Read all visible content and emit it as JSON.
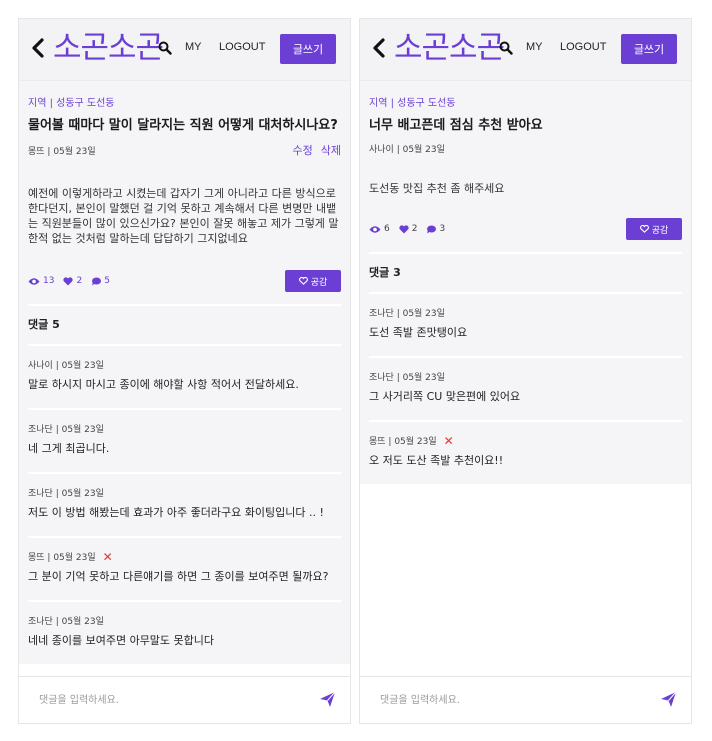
{
  "app": {
    "logo": "소곤소곤",
    "nav_my": "MY",
    "nav_logout": "LOGOUT",
    "write_label": "글쓰기",
    "accent_color": "#6b3fd4",
    "delete_color": "#e03a2e"
  },
  "left": {
    "post": {
      "region": "지역 | 성동구 도선동",
      "title": "물어볼 때마다 말이 달라지는 직원 어떻게 대처하시나요?",
      "author_date": "몽뜨  |  05월 23일",
      "edit_label": "수정",
      "delete_label": "삭제",
      "body": "예전에 이렇게하라고 시켰는데 갑자기 그게 아니라고 다른 방식으로 한다던지, 본인이 말했던 걸 기억 못하고 계속해서 다른 변명만 내뱉는 직원분들이 많이 있으신가요? 본인이 잘못 해놓고 제가 그렇게 말한적 없는 것처럼 말하는데 답답하기 그지없네요",
      "views": "13",
      "likes": "2",
      "comments": "5",
      "like_button": "공감"
    },
    "comment_count": "댓글 5",
    "comments": [
      {
        "meta": "사나이 | 05월 23일",
        "text": "말로 하시지 마시고 종이에 해야할 사항 적어서 전달하세요."
      },
      {
        "meta": "조나단 | 05월 23일",
        "text": "네 그게 최곱니다."
      },
      {
        "meta": "조나단 | 05월 23일",
        "text": "저도 이 방법 해봤는데 효과가 아주 좋더라구요 화이팅입니다 .. !"
      },
      {
        "meta": "몽뜨 | 05월 23일",
        "text": "그 분이 기억 못하고 다른얘기를 하면 그 종이를 보여주면 될까요?"
      },
      {
        "meta": "조나단 | 05월 23일",
        "text": "네네 종이를 보여주면 아무말도 못합니다"
      }
    ],
    "comment_placeholder": "댓글을 입력하세요."
  },
  "right": {
    "post": {
      "region": "지역 | 성동구 도선동",
      "title": "너무 배고픈데 점심 추천 받아요",
      "author_date": "사나이  |  05월 23일",
      "body": "도선동 맛집 추천 좀 해주세요",
      "views": "6",
      "likes": "2",
      "comments": "3",
      "like_button": "공감"
    },
    "comment_count": "댓글 3",
    "comments": [
      {
        "meta": "조나단 | 05월 23일",
        "text": "도선 족발 존맛탱이요"
      },
      {
        "meta": "조나단 | 05월 23일",
        "text": "그 사거리쪽 CU 맞은편에 있어요"
      },
      {
        "meta": "몽뜨 | 05월 23일",
        "text": "오 저도 도산 족발 추천이요!!"
      }
    ],
    "comment_placeholder": "댓글을 입력하세요."
  }
}
